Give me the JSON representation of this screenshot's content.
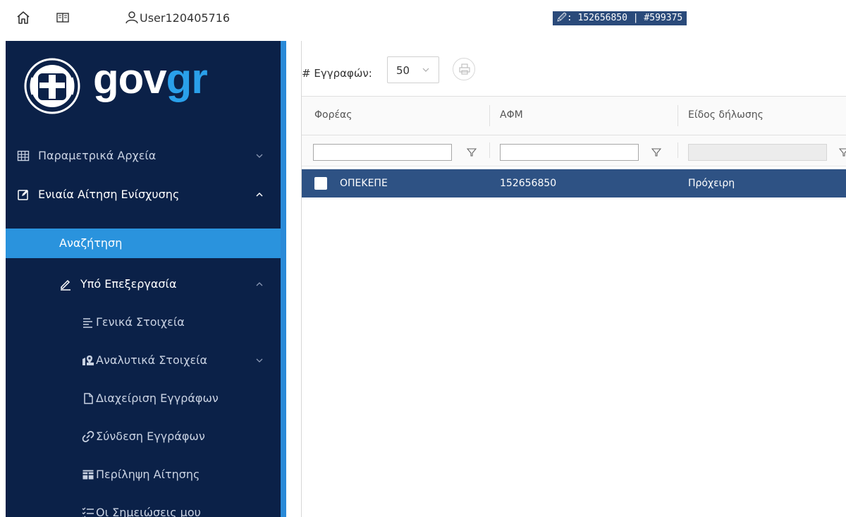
{
  "topbar": {
    "username": "User120405716",
    "badge": "🖉: 152656850 | #599375",
    "icons": [
      "home-icon",
      "book-icon",
      "user-icon"
    ]
  },
  "sidebar": {
    "logo": {
      "gov": "gov",
      "gr": "gr"
    },
    "items": [
      {
        "label": "Παραμετρικά Αρχεία",
        "icon": "table-icon",
        "expanded": false
      },
      {
        "label": "Ενιαία Αίτηση Ενίσχυσης",
        "icon": "edit-square-icon",
        "expanded": true
      },
      {
        "label": "Αναζήτηση",
        "active": true
      },
      {
        "label": "Υπό Επεξεργασία",
        "icon": "pencil-icon",
        "expanded": true
      },
      {
        "label": "Γενικά Στοιχεία",
        "icon": "align-left-icon"
      },
      {
        "label": "Αναλυτικά Στοιχεία",
        "icon": "map-pin-icon",
        "expanded": false
      },
      {
        "label": "Διαχείριση Εγγράφων",
        "icon": "file-icon"
      },
      {
        "label": "Σύνδεση Εγγράφων",
        "icon": "link-icon"
      },
      {
        "label": "Περίληψη Αίτησης",
        "icon": "grid-table-icon"
      },
      {
        "label": "Οι Σημειώσεις μου",
        "icon": "checklist-icon"
      }
    ],
    "colors": {
      "bg": "#0b2148",
      "active": "#2a93dd",
      "edge": "#2a8ad8"
    }
  },
  "main": {
    "records_label": "# Εγγραφών:",
    "records_value": "50",
    "columns": [
      "Φορέας",
      "ΑΦΜ",
      "Είδος δήλωσης"
    ],
    "rows": [
      {
        "foreas": "ΟΠΕΚΕΠΕ",
        "afm": "152656850",
        "eidos": "Πρόχειρη",
        "selected": true
      }
    ],
    "colors": {
      "selected_row": "#2e5284"
    }
  }
}
